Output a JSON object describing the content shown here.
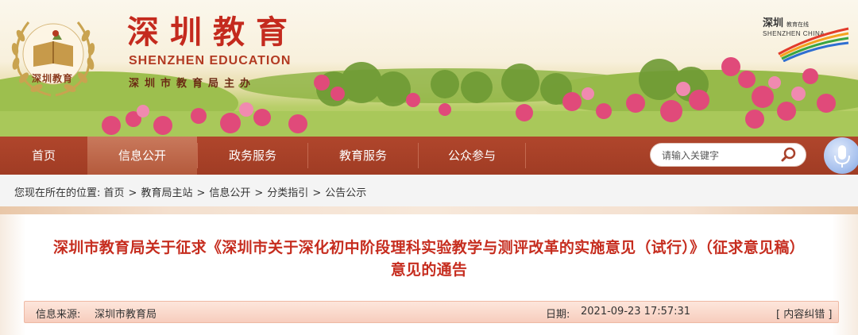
{
  "header": {
    "logo_text": "深圳教育",
    "title": "深圳教育",
    "subtitle_en": "SHENZHEN EDUCATION",
    "host": "深圳市教育局主办",
    "brand_cn": "深圳",
    "brand_cn_small": "教育在线",
    "brand_en": "SHENZHEN CHINA"
  },
  "nav": {
    "items": [
      {
        "label": "首页"
      },
      {
        "label": "信息公开",
        "active": true
      },
      {
        "label": "政务服务"
      },
      {
        "label": "教育服务"
      },
      {
        "label": "公众参与"
      }
    ],
    "search_placeholder": "请输入关键字",
    "accent": "#a8412a"
  },
  "breadcrumb": {
    "prefix": "您现在所在的位置:",
    "items": [
      "首页",
      "教育局主站",
      "信息公开",
      "分类指引",
      "公告公示"
    ],
    "separator": ">"
  },
  "article": {
    "title_line1": "深圳市教育局关于征求《深圳市关于深化初中阶段理科实验教学与测评改革的实施意见（试行）》（征求意见稿）",
    "title_line2": "意见的通告",
    "source_label": "信息来源:",
    "source_value": "深圳市教育局",
    "date_label": "日期:",
    "date_value": "2021-09-23 17:57:31",
    "correction": "[ 内容纠错 ]",
    "title_color": "#c62d1f"
  }
}
